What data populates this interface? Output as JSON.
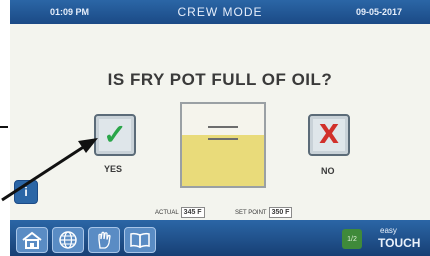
{
  "header": {
    "time": "01:09 PM",
    "mode": "CREW MODE",
    "date": "09-05-2017"
  },
  "prompt": {
    "question": "IS FRY POT FULL OF OIL?"
  },
  "choices": {
    "yes": {
      "label": "YES",
      "icon": "checkmark-icon",
      "glyph": "✓"
    },
    "no": {
      "label": "NO",
      "icon": "x-icon",
      "glyph": "X"
    }
  },
  "pot": {
    "oil_level": 0.62,
    "oil_color": "#e9db7a"
  },
  "info": {
    "glyph": "i"
  },
  "temps": {
    "actual_label": "ACTUAL",
    "actual_value": "345 F",
    "setpoint_label": "SET POINT",
    "setpoint_value": "350 F"
  },
  "nav": [
    "home-icon",
    "globe-icon",
    "help-hand-icon",
    "manual-book-icon"
  ],
  "footer": {
    "page": "1/2",
    "logo_top": "easy",
    "logo_bottom": "TOUCH"
  },
  "colors": {
    "bar_blue": "#2b66a6",
    "check_green": "#2aa64a",
    "x_red": "#d1302b"
  }
}
